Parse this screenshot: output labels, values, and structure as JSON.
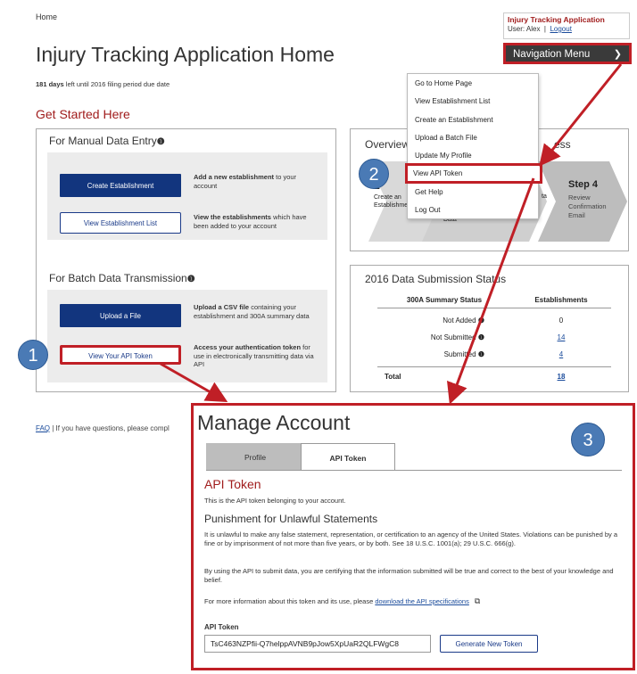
{
  "breadcrumb": "Home",
  "page_title": "Injury Tracking Application Home",
  "days_left": {
    "count": "181 days",
    "rest": " left until 2016 filing period due date"
  },
  "get_started": "Get Started Here",
  "user_box": {
    "app_name": "Injury Tracking Application",
    "user_label": "User: Alex",
    "separator": "|",
    "logout": "Logout"
  },
  "nav_menu": {
    "label": "Navigation Menu",
    "items": [
      "Go to Home Page",
      "View Establishment List",
      "Create an Establishment",
      "Upload a Batch File",
      "Update My Profile",
      "View API Token",
      "Get Help",
      "Log Out"
    ]
  },
  "manual": {
    "title": "For Manual Data Entry",
    "create_btn": "Create Establishment",
    "create_desc_pre": "Add a new establishment",
    "create_desc_post": " to your account",
    "view_btn": "View Establishment List",
    "view_desc_pre": "View the establishments",
    "view_desc_post": " which have been added to your account"
  },
  "batch": {
    "title": "For Batch Data Transmission",
    "upload_btn": "Upload a File",
    "upload_desc_pre": "Upload a CSV file",
    "upload_desc_post": " containing your establishment and 300A summary data",
    "token_btn": "View Your API Token",
    "token_desc_pre": "Access your authentication token",
    "token_desc_post": " for use in electronically transmitting data via API"
  },
  "overview": {
    "title_pre": "Overview",
    "title_post": "ess",
    "step1_label": "1",
    "step1_text": "Create an Establishment",
    "step_mid_text": "Data",
    "step_mid_side": "ta",
    "step4_label": "Step 4",
    "step4_text": "Review Confirmation Email"
  },
  "status": {
    "title": "2016 Data Submission Status",
    "col1": "300A Summary Status",
    "col2": "Establishments",
    "rows": [
      {
        "label": "Not Added",
        "value": "0",
        "link": false
      },
      {
        "label": "Not Submitted",
        "value": "14",
        "link": true
      },
      {
        "label": "Submitted",
        "value": "4",
        "link": true
      }
    ],
    "total_label": "Total",
    "total_value": "18"
  },
  "footer": {
    "faq": "FAQ",
    "text": " |  If you have questions, please compl"
  },
  "manage": {
    "title": "Manage Account",
    "tab_profile": "Profile",
    "tab_api": "API Token",
    "api_title": "API Token",
    "api_desc": "This is the API token belonging to your account.",
    "punish_title": "Punishment for Unlawful Statements",
    "para1": "It is unlawful to make any false statement, representation, or certification to an agency of the United States. Violations can be punished by a fine or by imprisonment of not more than five years, or by both. See 18 U.S.C. 1001(a); 29 U.S.C. 666(g).",
    "para2": "By using the API to submit data, you are certifying that the information submitted will be true and correct to the best of your knowledge and belief.",
    "para3_pre": "For more information about this token and its use, please ",
    "para3_link": "download the API specifications",
    "token_label": "API Token",
    "token_value": "TsC463NZPfii-Q7helppAVNB9pJow5XpUaR2QLFWgC8",
    "gen_btn": "Generate New Token"
  },
  "badges": [
    "1",
    "2",
    "3"
  ],
  "colors": {
    "accent_red": "#c01f26",
    "primary_blue": "#12357e",
    "title_red": "#a01c1c",
    "badge_blue": "#4a7ab5"
  }
}
